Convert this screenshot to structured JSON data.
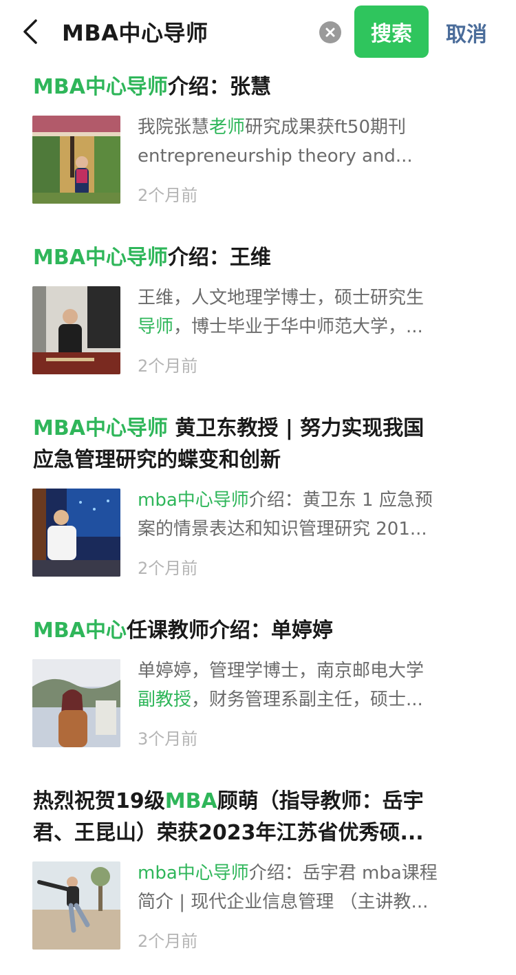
{
  "search": {
    "query": "MBA中心导师",
    "submit_label": "搜索",
    "cancel_label": "取消"
  },
  "colors": {
    "accent": "#2fc55d",
    "highlight": "#2fb65a",
    "link": "#4a6c9a",
    "snippet": "#6b6b6b",
    "time": "#b4b4b4"
  },
  "results": [
    {
      "title": {
        "lines": [
          [
            {
              "t": "MBA中心导师",
              "hl": true
            },
            {
              "t": "介绍：张慧",
              "hl": false
            }
          ]
        ]
      },
      "snippet": [
        [
          {
            "t": "我院张慧",
            "hl": false
          },
          {
            "t": "老师",
            "hl": true
          },
          {
            "t": "研究成果获ft50期刊",
            "hl": false
          }
        ],
        [
          {
            "t": "entrepreneurship theory and...",
            "hl": false
          }
        ]
      ],
      "time": "2个月前",
      "thumbnail_icon": "photo-woman-garden"
    },
    {
      "title": {
        "lines": [
          [
            {
              "t": "MBA中心导师",
              "hl": true
            },
            {
              "t": "介绍：王维",
              "hl": false
            }
          ]
        ]
      },
      "snippet": [
        [
          {
            "t": "王维，人文地理学博士，硕士研究生",
            "hl": false
          }
        ],
        [
          {
            "t": "导师",
            "hl": true
          },
          {
            "t": "，博士毕业于华中师范大学，...",
            "hl": false
          }
        ]
      ],
      "time": "2个月前",
      "thumbnail_icon": "photo-man-lectern"
    },
    {
      "title": {
        "lines": [
          [
            {
              "t": "MBA中心导师",
              "hl": true
            },
            {
              "t": " 黄卫东教授 | 努力实现我国",
              "hl": false
            }
          ],
          [
            {
              "t": "应急管理研究的蝶变和创新",
              "hl": false
            }
          ]
        ]
      },
      "snippet": [
        [
          {
            "t": "mba中心导师",
            "hl": true
          },
          {
            "t": "介绍：黄卫东 1 应急预",
            "hl": false
          }
        ],
        [
          {
            "t": "案的情景表达和知识管理研究 201...",
            "hl": false
          }
        ]
      ],
      "time": "2个月前",
      "thumbnail_icon": "photo-man-conference"
    },
    {
      "title": {
        "lines": [
          [
            {
              "t": "MBA中心",
              "hl": true
            },
            {
              "t": "任课教师介绍：单婷婷",
              "hl": false
            }
          ]
        ]
      },
      "snippet": [
        [
          {
            "t": "单婷婷，管理学博士，南京邮电大学",
            "hl": false
          }
        ],
        [
          {
            "t": "副教授",
            "hl": true
          },
          {
            "t": "，财务管理系副主任，硕士...",
            "hl": false
          }
        ]
      ],
      "time": "3个月前",
      "thumbnail_icon": "photo-woman-outdoor"
    },
    {
      "title": {
        "lines": [
          [
            {
              "t": "热烈祝贺19级",
              "hl": false
            },
            {
              "t": "MBA",
              "hl": true
            },
            {
              "t": "顾萌（指导教师：岳宇",
              "hl": false
            }
          ],
          [
            {
              "t": "君、王昆山）荣获2023年江苏省优秀硕...",
              "hl": false
            }
          ]
        ]
      },
      "snippet": [
        [
          {
            "t": "mba中心导师",
            "hl": true
          },
          {
            "t": "介绍：岳宇君 mba课程",
            "hl": false
          }
        ],
        [
          {
            "t": "简介 | 现代企业信息管理 （主讲教...",
            "hl": false
          }
        ]
      ],
      "time": "2个月前",
      "thumbnail_icon": "photo-man-jumping"
    }
  ]
}
